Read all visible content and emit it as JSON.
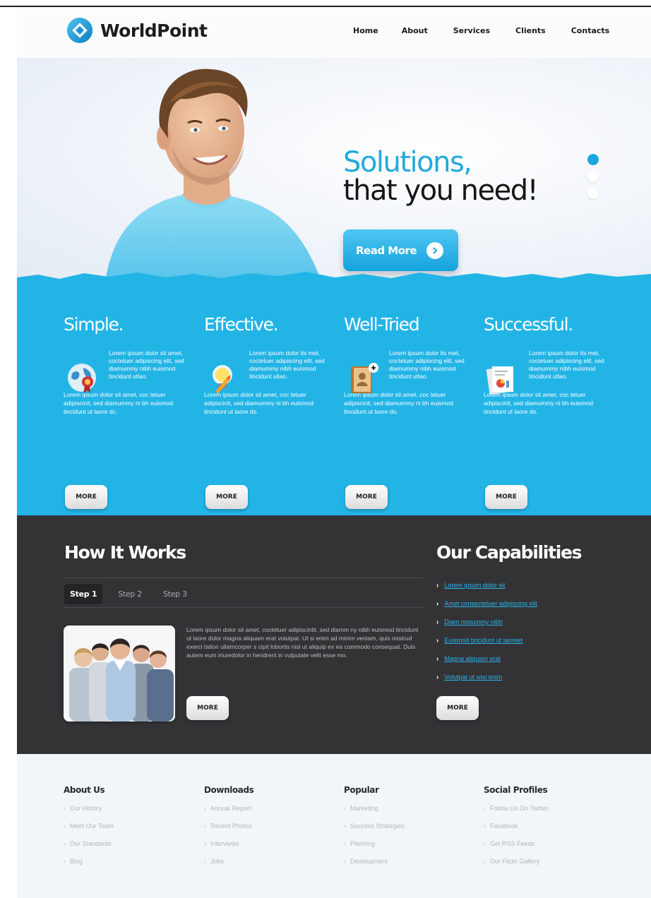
{
  "brand": {
    "name": "WorldPoint",
    "accent": "#23b4e6",
    "dark": "#333336"
  },
  "nav": [
    "Home",
    "About",
    "Services",
    "Clients",
    "Contacts"
  ],
  "hero": {
    "title_line1": "Solutions,",
    "title_line2": "that you need!",
    "button_label": "Read More",
    "slides_total": 3,
    "active_slide": 1
  },
  "features": [
    {
      "title": "Simple.",
      "icon": "globe-award-icon",
      "text_a": "Lorem ipsum dolor sit amet, coctetuer adipiscing elit, sed diamummy nibh euismod tincidunt utlao.",
      "text_b": "Lorem ipsum dolor sit amet, coc tetuer adipiscinit, sed diamummy ni bh euismod tincidunt ut laore dc.",
      "button": "MORE"
    },
    {
      "title": "Effective.",
      "icon": "lightbulb-icon",
      "text_a": "Lorem ipsum dolor its met, coctetuer adipiscing elit, sed diamummy nibh euismod tincidunt ullao.",
      "text_b": "Lorem ipsum dolor sit amet, coc tetuer adipiscinit, sed diamummy ni bh euismod tincidunt ut laore do.",
      "button": "MORE"
    },
    {
      "title": "Well-Tried",
      "icon": "address-book-icon",
      "text_a": "Lorem ipsum dolor its met, coctetuer adipiscing elit, sed diamummy nibh euismod tincidunt utlao.",
      "text_b": "Lorem ipsum dolor sit amet, coc tetuer adipiscinit, sed diamummy ni bh euismod tincidunt ut laore do.",
      "button": "MORE"
    },
    {
      "title": "Successful.",
      "icon": "documents-chart-icon",
      "text_a": "Lorem ipsum dolor its met, coctetuer adipiscing elit, sed diamummy nibh euismod tincidunt utlao.",
      "text_b": "Lorem ipsum dolor sit amet, coc tetuer adipiscinit, sed diamummy ni bh euismod tincidunt ut laore do.",
      "button": "MORE"
    }
  ],
  "how_it_works": {
    "title": "How It Works",
    "tabs": [
      "Step 1",
      "Step 2",
      "Step 3"
    ],
    "active_tab": 0,
    "text": "Lorem ipsum dolor sit amet, coctetuer adipiscinlit, sed diamm ny nibh euismod tincidunt ut laore dolor magna aliquam erat volutpat. Ut si enim ad minim veniam, quis nostrud exerci tation ullamcorper s cipit lobortis nisl ut aliquip ex ea commodo consequat. Duis autem eum iriuredolor in hendrerit in vulputate velit esse mo.",
    "button": "MORE"
  },
  "capabilities": {
    "title": "Our Capabilities",
    "items": [
      "Lorem ipsum dolor sit",
      "Amet consectetuer adipiscing elit",
      "Diam nonummy nibh",
      "Euismod tincidunt ut laoreet",
      "Magna aliquam erat",
      "Volutpat ut wisi enim"
    ],
    "button": "MORE"
  },
  "footer": [
    {
      "title": "About Us",
      "items": [
        "Our History",
        "Meet Our Team",
        "Our Standards",
        "Blog"
      ]
    },
    {
      "title": "Downloads",
      "items": [
        "Annual Report",
        "Recent Photos",
        "Interviews",
        "Jobs"
      ]
    },
    {
      "title": "Popular",
      "items": [
        "Marketing",
        "Success Strategies",
        "Planning",
        "Development"
      ]
    },
    {
      "title": "Social Profiles",
      "items": [
        "Follow Us On Twitter",
        "Facebook",
        "Get RSS Feeds",
        "Our Flickr Gallery"
      ]
    }
  ]
}
